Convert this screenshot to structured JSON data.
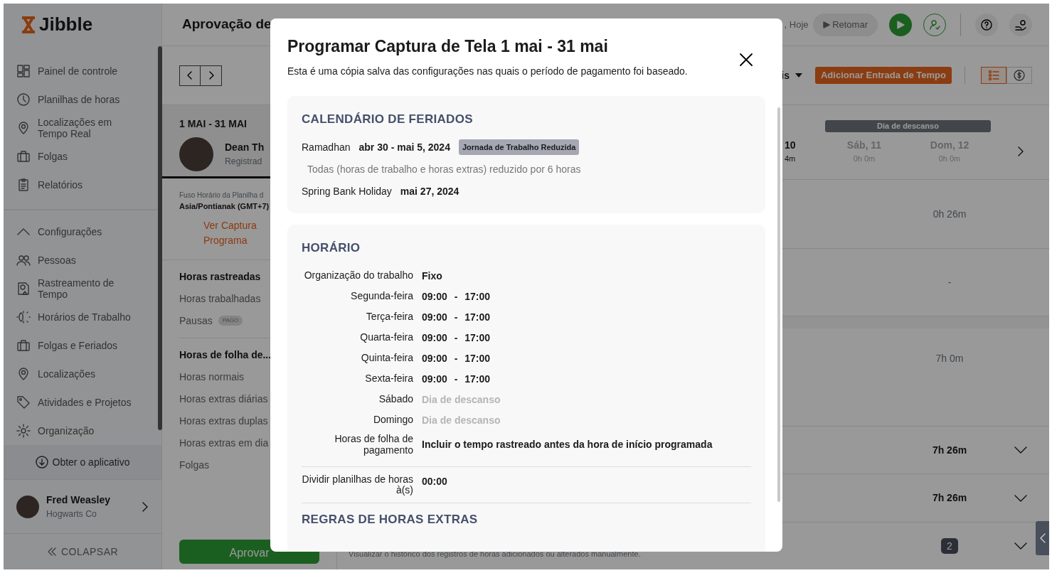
{
  "sidebar": {
    "logo": "Jibble",
    "items": [
      {
        "label": "Painel de controle"
      },
      {
        "label": "Planilhas de horas"
      },
      {
        "label": "Localizações em Tempo Real"
      },
      {
        "label": "Folgas"
      },
      {
        "label": "Relatórios"
      }
    ],
    "settings": {
      "label": "Configurações",
      "expanded": true,
      "items": [
        {
          "label": "Pessoas"
        },
        {
          "label": "Rastreamento de Tempo"
        },
        {
          "label": "Horários de Trabalho"
        },
        {
          "label": "Folgas e Feriados"
        },
        {
          "label": "Localizações"
        },
        {
          "label": "Atividades e Projetos"
        },
        {
          "label": "Organização"
        }
      ]
    },
    "get_app": "Obter o aplicativo",
    "user": {
      "name": "Fred Weasley",
      "org": "Hogwarts Co"
    },
    "collapse": "COLAPSAR"
  },
  "header": {
    "title": "Aprovação de",
    "date": ", Hoje",
    "resume": "Retomar"
  },
  "period_panel": {
    "range": "1 MAI - 31 MAI",
    "employee": {
      "name": "Dean Th",
      "status": "Registrad"
    },
    "timezone_label": "Fuso Horário da Planilha d",
    "timezone": "Asia/Pontianak (GMT+7)",
    "link_lines": [
      "Ver Captura",
      "Programa"
    ],
    "tracked": {
      "title": "Horas rastreadas",
      "rows": [
        {
          "label": "Horas trabalhadas"
        },
        {
          "label": "Pausas",
          "badge": "PAGO"
        }
      ]
    },
    "payroll": {
      "title": "Horas de folha de...",
      "rows": [
        {
          "label": "Horas normais"
        },
        {
          "label": "Horas extras diárias"
        },
        {
          "label": "Horas extras duplas"
        },
        {
          "label": "Horas extras em dia"
        },
        {
          "label": "Folgas"
        }
      ]
    },
    "approve": "Aprovar"
  },
  "toolbar": {
    "filter": "is",
    "add_button": "Adicionar Entrada de Tempo",
    "views": [
      {
        "selected": true
      },
      {
        "selected": false
      }
    ]
  },
  "week": {
    "rest_banner": "Dia de descanso",
    "days": [
      {
        "day": "10",
        "total": "4m",
        "rest": false
      },
      {
        "day": "Sáb, 11",
        "total": "0h 0m",
        "rest": true
      },
      {
        "day": "Dom, 12",
        "total": "0h 0m",
        "rest": true
      }
    ]
  },
  "rows": [
    {
      "kind": "plain",
      "value": "0h 26m"
    },
    {
      "kind": "plain",
      "value": "-"
    },
    {
      "kind": "plain",
      "value": "7h 0m"
    },
    {
      "kind": "total",
      "value": "7h 26m"
    },
    {
      "kind": "total",
      "value": "7h 26m"
    },
    {
      "kind": "count",
      "value": "2"
    }
  ],
  "history_note": "Visualizar o histórico dos registros de horas adicionados ou alterados manualmente.",
  "modal": {
    "title": "Programar Captura de Tela 1 mai - 31 mai",
    "subtitle": "Esta é uma cópia salva das configurações nas quais o período de pagamento foi baseado.",
    "holidays": {
      "title": "CALENDÁRIO DE FERIADOS",
      "items": [
        {
          "name": "Ramadhan",
          "dates": "abr 30 - mai 5, 2024",
          "tag": "Jornada de Trabalho Reduzida",
          "note": "Todas (horas de trabalho e horas extras) reduzido por 6 horas"
        },
        {
          "name": "Spring Bank Holiday",
          "dates": "mai 27, 2024"
        }
      ]
    },
    "schedule": {
      "title": "HORÁRIO",
      "rows": [
        {
          "kind": "text",
          "label": "Organização do trabalho",
          "value": "Fixo"
        },
        {
          "kind": "hours",
          "label": "Segunda-feira",
          "value": "09:00 - 17:00"
        },
        {
          "kind": "hours",
          "label": "Terça-feira",
          "value": "09:00 - 17:00"
        },
        {
          "kind": "hours",
          "label": "Quarta-feira",
          "value": "09:00 - 17:00"
        },
        {
          "kind": "hours",
          "label": "Quinta-feira",
          "value": "09:00 - 17:00"
        },
        {
          "kind": "hours",
          "label": "Sexta-feira",
          "value": "09:00 - 17:00"
        },
        {
          "kind": "rest",
          "label": "Sábado",
          "value": "Dia de descanso"
        },
        {
          "kind": "rest",
          "label": "Domingo",
          "value": "Dia de descanso"
        },
        {
          "kind": "text",
          "label": "Horas de folha de pagamento",
          "value": "Incluir o tempo rastreado antes da hora de início programada"
        }
      ],
      "split": {
        "label": "Dividir planilhas de horas à(s)",
        "value": "00:00"
      }
    },
    "overtime": {
      "title": "REGRAS DE HORAS EXTRAS"
    }
  }
}
